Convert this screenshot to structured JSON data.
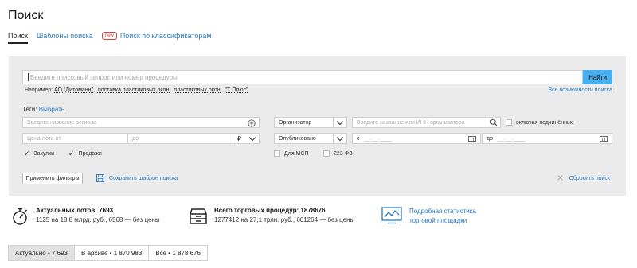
{
  "page": {
    "title": "Поиск"
  },
  "tabs": [
    {
      "label": "Поиск",
      "active": true
    },
    {
      "label": "Шаблоны поиска",
      "active": false
    },
    {
      "label": "Поиск по классификаторам",
      "badge": "new",
      "active": false
    }
  ],
  "search": {
    "placeholder": "Введите поисковый запрос или номер процедуры",
    "button": "Найти",
    "example_prefix": "Например:",
    "examples": [
      "АО \"Дитоманн\",",
      "поставка пластиковых окон,",
      "пластиковых окон,",
      "\"Т Плюс\""
    ],
    "all_options": "Все возможности поиска"
  },
  "tags": {
    "label": "Теги:",
    "choose": "Выбрать"
  },
  "filters": {
    "region_placeholder": "Введите название региона",
    "price_from": "Цена лота от",
    "price_to": "до",
    "currency": "₽",
    "organizer_select": "Организатор",
    "organizer_placeholder": "Введите название или ИНН организатора",
    "include_subordinate": "включая подчинённые",
    "published_select": "Опубликовано",
    "date_from": "с",
    "date_from_mask": "__.__.____",
    "date_to": "до",
    "date_to_mask": "__.__.____",
    "purchases": "Закупки",
    "sales": "Продажи",
    "for_sme": "Для МСП",
    "law_223": "223-ФЗ",
    "checkmark": "✓"
  },
  "actions": {
    "apply": "Применить фильтры",
    "save_template": "Сохранить шаблон поиска",
    "reset": "Сбросить поиск"
  },
  "stats": {
    "lots_title": "Актуальных лотов: 7693",
    "lots_sub": "1125 на 18,8 млрд. руб., 6568 — без цены",
    "procedures_title": "Всего торговых процедур: 1878676",
    "procedures_sub": "1277412 на 27,1 трлн. руб., 601264 — без цены",
    "detail_link_1": "Подробная статистика",
    "detail_link_2": "торговой площадки"
  },
  "bottom_tabs": [
    {
      "label": "Актуально • 7 693",
      "active": true
    },
    {
      "label": "В архиве • 1 870 983",
      "active": false
    },
    {
      "label": "Все • 1 878 676",
      "active": false
    }
  ],
  "colors": {
    "accent": "#2a7bc4",
    "search_button": "#47aef0",
    "panel_bg": "#ebebeb",
    "badge": "#e0403a"
  }
}
